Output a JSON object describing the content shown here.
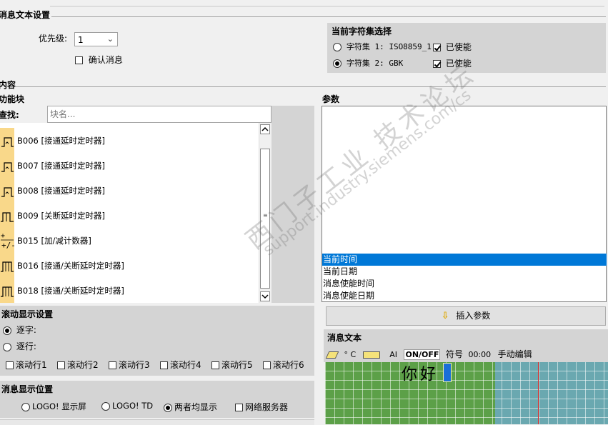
{
  "msg_text_settings": {
    "title": "消息文本设置"
  },
  "priority": {
    "label": "优先级:",
    "value": "1"
  },
  "confirm_message": {
    "label": "确认消息",
    "checked": false
  },
  "charset": {
    "title": "当前字符集选择",
    "items": [
      {
        "label": "字符集 1: ISO8859_1",
        "selected": false,
        "enabled_label": "已使能",
        "enabled": true
      },
      {
        "label": "字符集 2: GBK",
        "selected": true,
        "enabled_label": "已使能",
        "enabled": true
      }
    ]
  },
  "content": {
    "title": "内容"
  },
  "function_blocks": {
    "title": "功能块",
    "search_label": "查找:",
    "search_placeholder": "块名...",
    "items": [
      {
        "label": "B006 [接通延时定时器]",
        "icon": "on-delay-timer-icon"
      },
      {
        "label": "B007 [接通延时定时器]",
        "icon": "on-delay-timer-icon"
      },
      {
        "label": "B008 [接通延时定时器]",
        "icon": "on-delay-timer-icon"
      },
      {
        "label": "B009 [关断延时定时器]",
        "icon": "off-delay-timer-icon"
      },
      {
        "label": "B015 [加/减计数器]",
        "icon": "up-down-counter-icon"
      },
      {
        "label": "B016 [接通/关断延时定时器]",
        "icon": "on-off-delay-timer-icon"
      },
      {
        "label": "B018 [接通/关断延时定时器]",
        "icon": "on-off-delay-timer-icon"
      }
    ]
  },
  "parameters": {
    "title": "参数",
    "items": [
      {
        "label": "当前时间",
        "selected": true
      },
      {
        "label": "当前日期",
        "selected": false
      },
      {
        "label": "消息使能时间",
        "selected": false
      },
      {
        "label": "消息使能日期",
        "selected": false
      }
    ],
    "insert_button": "插入参数"
  },
  "scroll_settings": {
    "title": "滚动显示设置",
    "options": [
      {
        "label": "逐字:",
        "selected": true
      },
      {
        "label": "逐行:",
        "selected": false
      }
    ],
    "lines": [
      {
        "label": "滚动行1",
        "checked": false
      },
      {
        "label": "滚动行2",
        "checked": false
      },
      {
        "label": "滚动行3",
        "checked": false
      },
      {
        "label": "滚动行4",
        "checked": false
      },
      {
        "label": "滚动行5",
        "checked": false
      },
      {
        "label": "滚动行6",
        "checked": false
      }
    ]
  },
  "display_position": {
    "title": "消息显示位置",
    "options": [
      {
        "label": "LOGO! 显示屏",
        "type": "radio",
        "selected": false
      },
      {
        "label": "LOGO! TD",
        "type": "radio",
        "selected": false
      },
      {
        "label": "两者均显示",
        "type": "radio",
        "selected": true
      },
      {
        "label": "网络服务器",
        "type": "checkbox",
        "selected": false
      }
    ]
  },
  "message_text": {
    "title": "消息文本",
    "toolbar": {
      "degree_c": "° C",
      "ai": "AI",
      "onoff": "ON/OFF",
      "symbol": "符号",
      "time": "00:00",
      "manual_edit": "手动编辑"
    },
    "text": "你好"
  },
  "watermark": {
    "line1": "西门子工业 技术论坛",
    "line2": "support.industry.siemens.com/cs"
  },
  "colors": {
    "selection": "#0078d7",
    "green_grid": "#5ca048",
    "teal_grid": "#6aa8b0",
    "fb_icon_bg": "#f9d88a"
  }
}
